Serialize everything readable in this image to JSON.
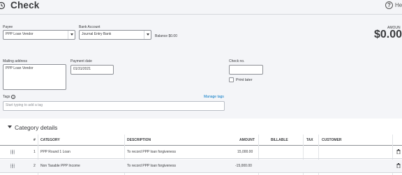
{
  "header": {
    "title": "Check",
    "help_label": "Hel"
  },
  "payee": {
    "label": "Payee",
    "value": "PPP Loan Vendor"
  },
  "bank_account": {
    "label": "Bank Account",
    "value": "Journal Entry Bank",
    "balance_text": "Balance $0.00"
  },
  "amount": {
    "label": "AMOUN",
    "value": "$0.00"
  },
  "mailing_address": {
    "label": "Mailing address",
    "value": "PPP Loan Vendor"
  },
  "payment_date": {
    "label": "Payment date",
    "value": "01/31/2021"
  },
  "check_no": {
    "label": "Check no.",
    "value": ""
  },
  "print_later": {
    "label": "Print later",
    "checked": false
  },
  "tags": {
    "label": "Tags",
    "manage_label": "Manage tags",
    "placeholder": "Start typing to add a tag"
  },
  "category_details": {
    "title": "Category details",
    "columns": [
      "#",
      "CATEGORY",
      "DESCRIPTION",
      "AMOUNT",
      "BILLABLE",
      "TAX",
      "CUSTOMER"
    ],
    "rows": [
      {
        "num": "1",
        "category": "PPP Round 1 Loan",
        "description": "To record PPP loan forgiveness",
        "amount": "15,000.00"
      },
      {
        "num": "2",
        "category": "Non Taxable PPP Income",
        "description": "To record PPP loan forgiveness",
        "amount": "-15,000.00"
      }
    ]
  },
  "icons": {
    "title": "check-sync-icon",
    "help": "help-icon",
    "tags_help": "question-icon",
    "section_toggle": "caret-down-icon",
    "drag": "drag-handle-icon",
    "delete": "trash-icon"
  }
}
